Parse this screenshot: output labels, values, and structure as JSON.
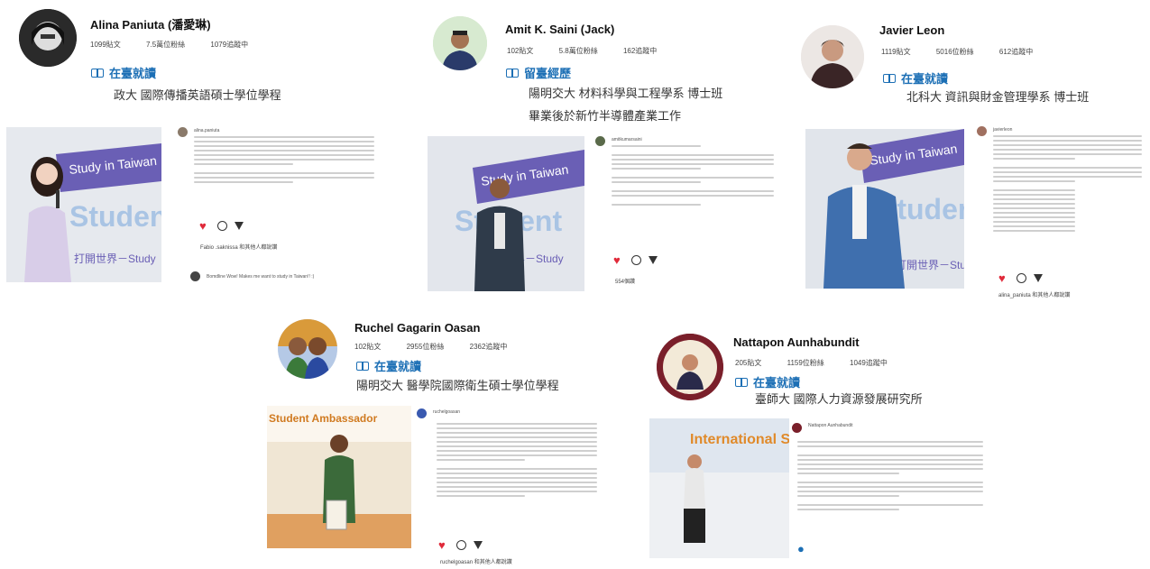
{
  "profiles": [
    {
      "name": "Alina Paniuta (潘愛琳)",
      "stats": [
        "1099貼文",
        "7.5萬位粉絲",
        "1079追蹤中"
      ],
      "status": "在臺就讀",
      "affiliation": [
        "政大 國際傳播英語碩士學位學程"
      ],
      "post_header": "alina.paniuta",
      "likes": "Fabio .saknissa 和其他人都說讚",
      "comment": "Bomdline Wow! Makes me want to study in Taiwan!! :)"
    },
    {
      "name": "Amit K. Saini (Jack)",
      "stats": [
        "102貼文",
        "5.8萬位粉絲",
        "162追蹤中"
      ],
      "status": "留臺經歷",
      "affiliation": [
        "陽明交大 材料科學與工程學系 博士班",
        "畢業後於新竹半導體產業工作"
      ],
      "post_header": "amitkumarsaini",
      "likes": "554個讚",
      "comment": ""
    },
    {
      "name": "Javier Leon",
      "stats": [
        "1119貼文",
        "5016位粉絲",
        "612追蹤中"
      ],
      "status": "在臺就讀",
      "affiliation": [
        "北科大 資訊與財金管理學系 博士班"
      ],
      "post_header": "javierleon",
      "likes": "alina_paniuta 和其他人都說讚",
      "comment": ""
    },
    {
      "name": "Ruchel Gagarin Oasan",
      "stats": [
        "102貼文",
        "2955位粉絲",
        "2362追蹤中"
      ],
      "status": "在臺就讀",
      "affiliation": [
        "陽明交大 醫學院國際衛生碩士學位學程"
      ],
      "post_header": "ruchelgoasan",
      "likes": "ruchelgoasan 和其他人都說讚",
      "comment": ""
    },
    {
      "name": "Nattapon Aunhabundit",
      "stats": [
        "205貼文",
        "1159位粉絲",
        "1049追蹤中"
      ],
      "status": "在臺就讀",
      "affiliation": [
        "臺師大 國際人力資源發展研究所"
      ],
      "post_header": "Nattapon Aunhabundit",
      "likes": "",
      "comment": ""
    }
  ],
  "photo_banner": {
    "study": "Study in Taiwan",
    "student": "Student",
    "world": "打開世界－Study",
    "ambassador": "Student Ambassador",
    "international": "International Student Ambassador"
  },
  "colors": {
    "accent": "#1c6fb5",
    "heart": "#e02a3a",
    "banner": "#6a5fb5"
  }
}
